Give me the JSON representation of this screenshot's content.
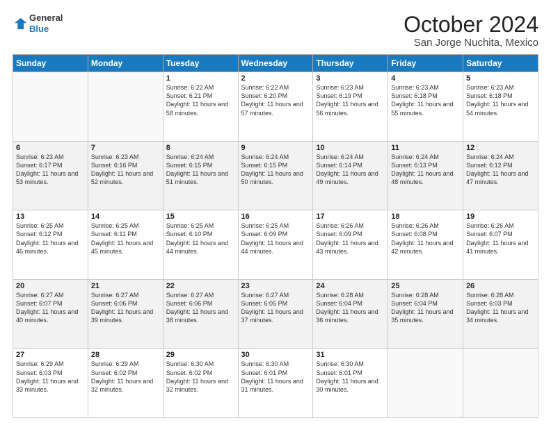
{
  "header": {
    "logo_line1": "General",
    "logo_line2": "Blue",
    "month": "October 2024",
    "location": "San Jorge Nuchita, Mexico"
  },
  "weekdays": [
    "Sunday",
    "Monday",
    "Tuesday",
    "Wednesday",
    "Thursday",
    "Friday",
    "Saturday"
  ],
  "weeks": [
    [
      {
        "day": "",
        "info": ""
      },
      {
        "day": "",
        "info": ""
      },
      {
        "day": "1",
        "info": "Sunrise: 6:22 AM\nSunset: 6:21 PM\nDaylight: 11 hours and 58 minutes."
      },
      {
        "day": "2",
        "info": "Sunrise: 6:22 AM\nSunset: 6:20 PM\nDaylight: 11 hours and 57 minutes."
      },
      {
        "day": "3",
        "info": "Sunrise: 6:23 AM\nSunset: 6:19 PM\nDaylight: 11 hours and 56 minutes."
      },
      {
        "day": "4",
        "info": "Sunrise: 6:23 AM\nSunset: 6:18 PM\nDaylight: 11 hours and 55 minutes."
      },
      {
        "day": "5",
        "info": "Sunrise: 6:23 AM\nSunset: 6:18 PM\nDaylight: 11 hours and 54 minutes."
      }
    ],
    [
      {
        "day": "6",
        "info": "Sunrise: 6:23 AM\nSunset: 6:17 PM\nDaylight: 11 hours and 53 minutes."
      },
      {
        "day": "7",
        "info": "Sunrise: 6:23 AM\nSunset: 6:16 PM\nDaylight: 11 hours and 52 minutes."
      },
      {
        "day": "8",
        "info": "Sunrise: 6:24 AM\nSunset: 6:15 PM\nDaylight: 11 hours and 51 minutes."
      },
      {
        "day": "9",
        "info": "Sunrise: 6:24 AM\nSunset: 6:15 PM\nDaylight: 11 hours and 50 minutes."
      },
      {
        "day": "10",
        "info": "Sunrise: 6:24 AM\nSunset: 6:14 PM\nDaylight: 11 hours and 49 minutes."
      },
      {
        "day": "11",
        "info": "Sunrise: 6:24 AM\nSunset: 6:13 PM\nDaylight: 11 hours and 48 minutes."
      },
      {
        "day": "12",
        "info": "Sunrise: 6:24 AM\nSunset: 6:12 PM\nDaylight: 11 hours and 47 minutes."
      }
    ],
    [
      {
        "day": "13",
        "info": "Sunrise: 6:25 AM\nSunset: 6:12 PM\nDaylight: 11 hours and 46 minutes."
      },
      {
        "day": "14",
        "info": "Sunrise: 6:25 AM\nSunset: 6:11 PM\nDaylight: 11 hours and 45 minutes."
      },
      {
        "day": "15",
        "info": "Sunrise: 6:25 AM\nSunset: 6:10 PM\nDaylight: 11 hours and 44 minutes."
      },
      {
        "day": "16",
        "info": "Sunrise: 6:25 AM\nSunset: 6:09 PM\nDaylight: 11 hours and 44 minutes."
      },
      {
        "day": "17",
        "info": "Sunrise: 6:26 AM\nSunset: 6:09 PM\nDaylight: 11 hours and 43 minutes."
      },
      {
        "day": "18",
        "info": "Sunrise: 6:26 AM\nSunset: 6:08 PM\nDaylight: 11 hours and 42 minutes."
      },
      {
        "day": "19",
        "info": "Sunrise: 6:26 AM\nSunset: 6:07 PM\nDaylight: 11 hours and 41 minutes."
      }
    ],
    [
      {
        "day": "20",
        "info": "Sunrise: 6:27 AM\nSunset: 6:07 PM\nDaylight: 11 hours and 40 minutes."
      },
      {
        "day": "21",
        "info": "Sunrise: 6:27 AM\nSunset: 6:06 PM\nDaylight: 11 hours and 39 minutes."
      },
      {
        "day": "22",
        "info": "Sunrise: 6:27 AM\nSunset: 6:06 PM\nDaylight: 11 hours and 38 minutes."
      },
      {
        "day": "23",
        "info": "Sunrise: 6:27 AM\nSunset: 6:05 PM\nDaylight: 11 hours and 37 minutes."
      },
      {
        "day": "24",
        "info": "Sunrise: 6:28 AM\nSunset: 6:04 PM\nDaylight: 11 hours and 36 minutes."
      },
      {
        "day": "25",
        "info": "Sunrise: 6:28 AM\nSunset: 6:04 PM\nDaylight: 11 hours and 35 minutes."
      },
      {
        "day": "26",
        "info": "Sunrise: 6:28 AM\nSunset: 6:03 PM\nDaylight: 11 hours and 34 minutes."
      }
    ],
    [
      {
        "day": "27",
        "info": "Sunrise: 6:29 AM\nSunset: 6:03 PM\nDaylight: 11 hours and 33 minutes."
      },
      {
        "day": "28",
        "info": "Sunrise: 6:29 AM\nSunset: 6:02 PM\nDaylight: 11 hours and 32 minutes."
      },
      {
        "day": "29",
        "info": "Sunrise: 6:30 AM\nSunset: 6:02 PM\nDaylight: 11 hours and 32 minutes."
      },
      {
        "day": "30",
        "info": "Sunrise: 6:30 AM\nSunset: 6:01 PM\nDaylight: 11 hours and 31 minutes."
      },
      {
        "day": "31",
        "info": "Sunrise: 6:30 AM\nSunset: 6:01 PM\nDaylight: 11 hours and 30 minutes."
      },
      {
        "day": "",
        "info": ""
      },
      {
        "day": "",
        "info": ""
      }
    ]
  ]
}
